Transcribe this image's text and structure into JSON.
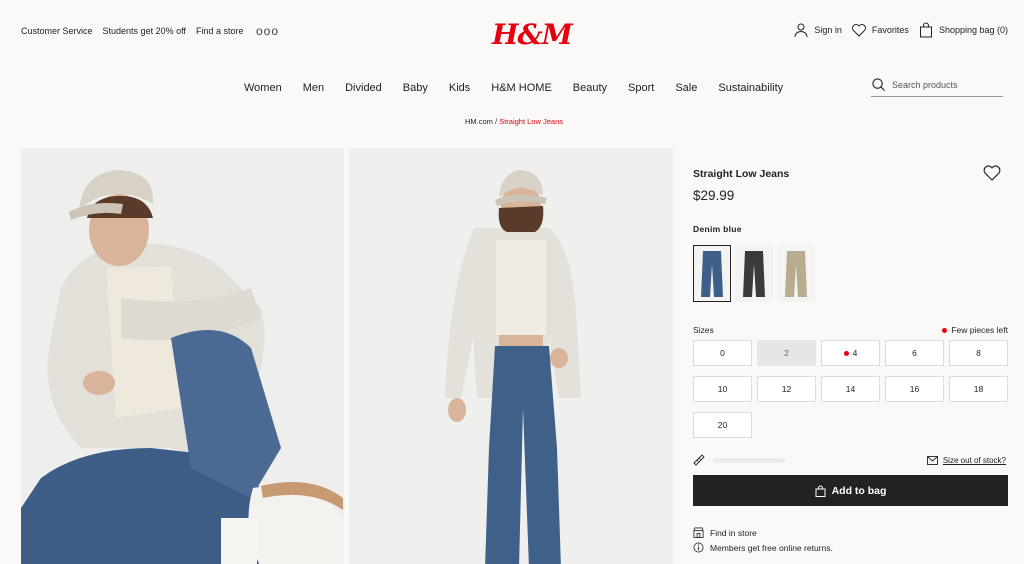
{
  "header": {
    "util_links": [
      "Customer Service",
      "Students get 20% off",
      "Find a store"
    ],
    "more": "ooo",
    "logo": "H&M",
    "signin": "Sign in",
    "favorites": "Favorites",
    "bag": "Shopping bag (0)"
  },
  "nav": [
    "Women",
    "Men",
    "Divided",
    "Baby",
    "Kids",
    "H&M HOME",
    "Beauty",
    "Sport",
    "Sale",
    "Sustainability"
  ],
  "search": {
    "placeholder": "Search products"
  },
  "breadcrumb": {
    "home": "HM.com",
    "sep": "/",
    "current": "Straight Low Jeans"
  },
  "product": {
    "title": "Straight Low Jeans",
    "price": "$29.99",
    "color_name": "Denim blue",
    "swatches": [
      "Denim blue",
      "Black",
      "Beige"
    ],
    "sizes_label": "Sizes",
    "few_left": "Few pieces left",
    "sizes": [
      "0",
      "2",
      "4",
      "6",
      "8",
      "10",
      "12",
      "14",
      "16",
      "18",
      "20"
    ],
    "size_out_of_stock": "Size out of stock?",
    "add_to_bag": "Add to bag",
    "find_in_store": "Find in store",
    "returns": "Members get free online returns."
  },
  "colors": {
    "brand_red": "#e50010",
    "button_dark": "#222222"
  }
}
